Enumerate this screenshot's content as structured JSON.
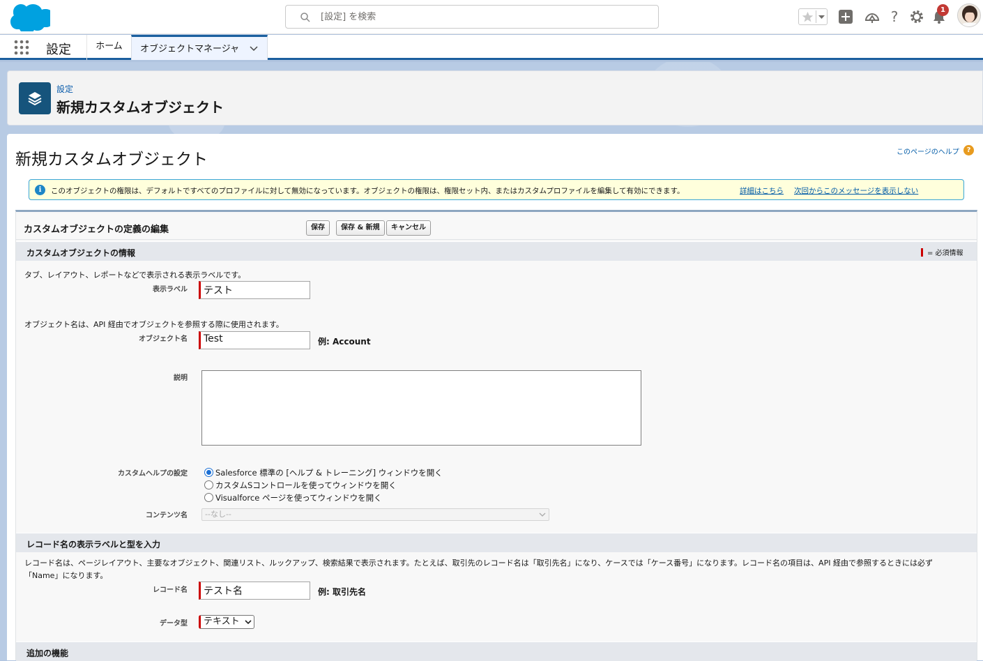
{
  "header": {
    "search_placeholder": "[設定] を検索",
    "notification_count": "1"
  },
  "nav": {
    "app_name": "設定",
    "home_tab": "ホーム",
    "active_tab": "オブジェクトマネージャ"
  },
  "page_header": {
    "breadcrumb": "設定",
    "title": "新規カスタムオブジェクト"
  },
  "content": {
    "title": "新規カスタムオブジェクト",
    "help_link": "このページのヘルプ",
    "help_icon": "?",
    "info_message": "このオブジェクトの権限は、デフォルトですべてのプロファイルに対して無効になっています。オブジェクトの権限は、権限セット内、またはカスタムプロファイルを編集して有効にできます。",
    "info_link_details": "詳細はこちら",
    "info_link_dismiss": "次回からこのメッセージを表示しない"
  },
  "form": {
    "title": "カスタムオブジェクトの定義の編集",
    "save_label": "保存",
    "save_new_label": "保存 & 新規",
    "cancel_label": "キャンセル",
    "section_info": {
      "title": "カスタムオブジェクトの情報",
      "required_legend": "= 必須情報",
      "label_desc": "タブ、レイアウト、レポートなどで表示される表示ラベルです。",
      "label_field": "表示ラベル",
      "label_value": "テスト",
      "object_name_desc": "オブジェクト名は、API 経由でオブジェクトを参照する際に使用されます。",
      "object_name_field": "オブジェクト名",
      "object_name_value": "Test",
      "object_name_example": "例:  Account",
      "description_field": "説明",
      "description_value": "",
      "custom_help_field": "カスタムヘルプの設定",
      "help_options": [
        {
          "label": "Salesforce 標準の [ヘルプ & トレーニング] ウィンドウを開く",
          "selected": true
        },
        {
          "label": "カスタムSコントロールを使ってウィンドウを開く",
          "selected": false
        },
        {
          "label": "Visualforce ページを使ってウィンドウを開く",
          "selected": false
        }
      ],
      "content_name_field": "コンテンツ名",
      "content_name_value": "--なし--"
    },
    "section_record": {
      "title": "レコード名の表示ラベルと型を入力",
      "desc_line1": "レコード名は、ページレイアウト、主要なオブジェクト、関連リスト、ルックアップ、検索結果で表示されます。たとえば、取引先のレコード名は「取引先名」になり、ケースでは「ケース番号」になります。レコード名の項目は、API 経由で参照するときには必ず",
      "desc_line2": "「Name」になります。",
      "record_name_field": "レコード名",
      "record_name_value": "テスト名",
      "record_name_example": "例:  取引先名",
      "data_type_field": "データ型",
      "data_type_value": "テキスト"
    },
    "section_extra": {
      "title": "追加の機能"
    }
  },
  "colors": {
    "brand_blue": "#1b5f9e",
    "cloud_blue": "#00a1e0",
    "required_red": "#cc0000",
    "badge_red": "#c23934"
  }
}
